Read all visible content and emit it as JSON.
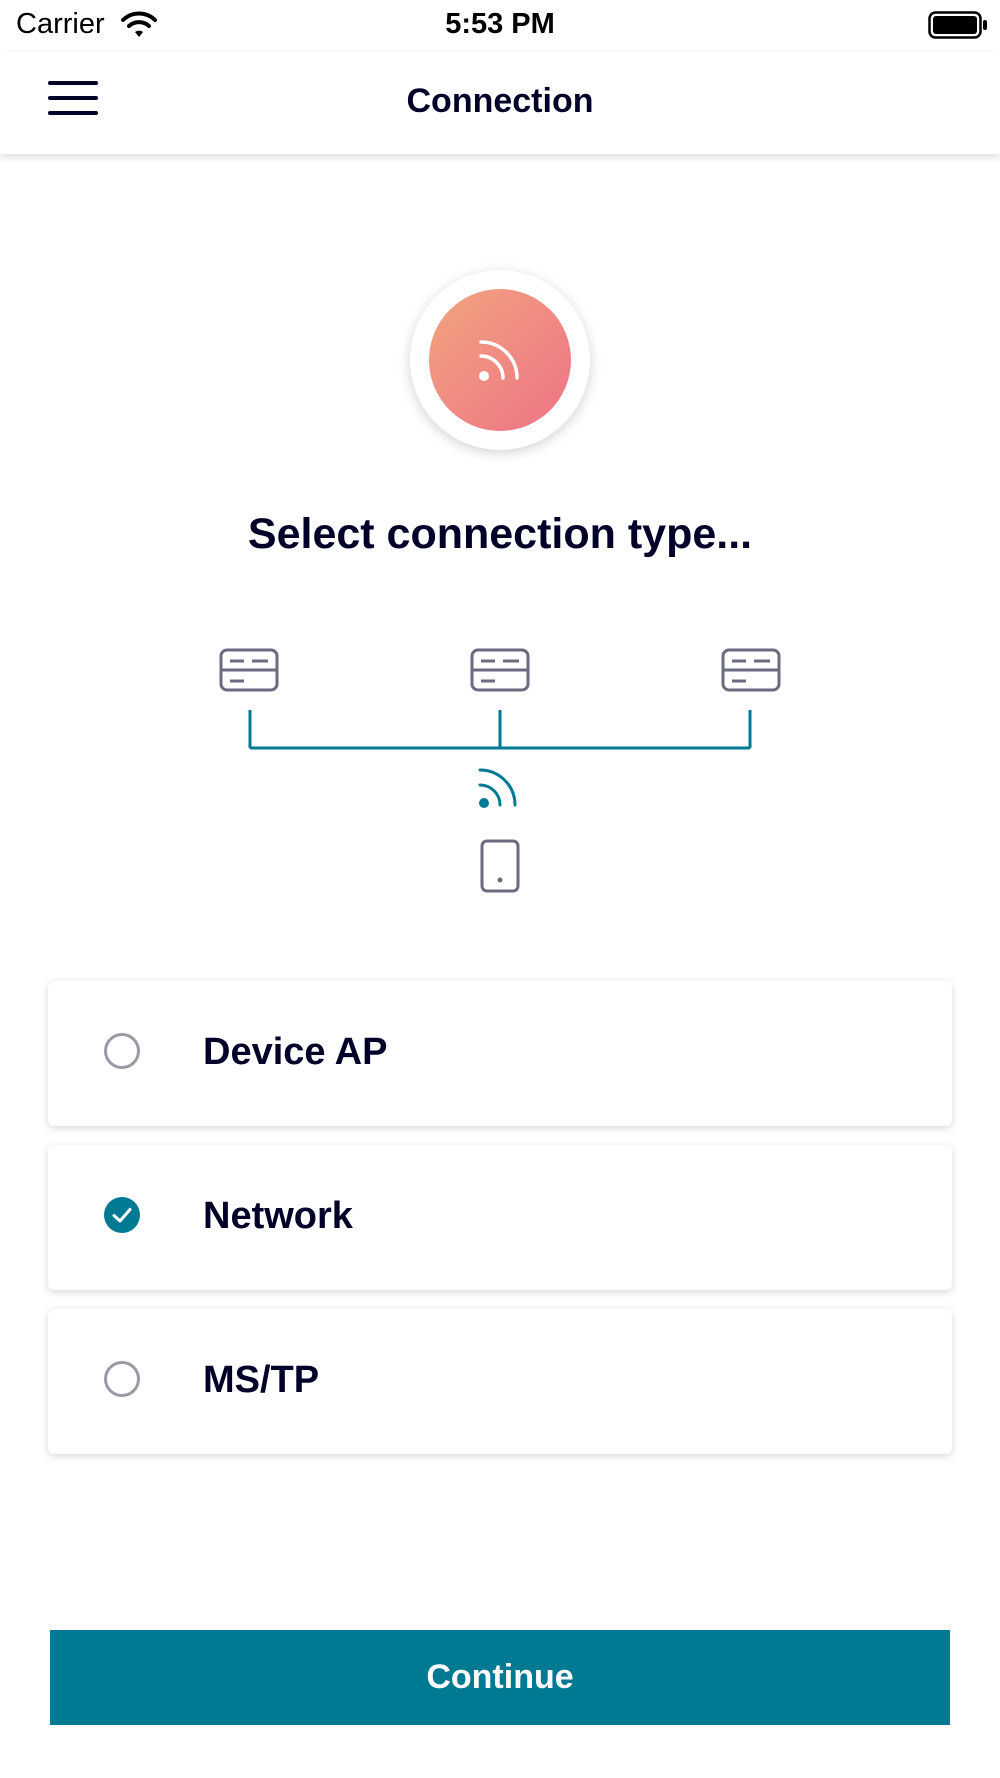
{
  "status_bar": {
    "carrier": "Carrier",
    "time": "5:53 PM",
    "wifi_icon": "wifi-icon",
    "battery_icon": "battery-icon"
  },
  "header": {
    "title": "Connection",
    "menu_icon": "hamburger-menu-icon"
  },
  "hero": {
    "icon": "wireless-signal-icon",
    "gradient": [
      "#f0a47e",
      "#ef7386"
    ]
  },
  "prompt": "Select connection type...",
  "diagram": {
    "icons": [
      "device-icon",
      "device-icon",
      "device-icon",
      "wireless-signal-icon",
      "phone-icon"
    ]
  },
  "options": [
    {
      "label": "Device AP",
      "selected": false
    },
    {
      "label": "Network",
      "selected": true
    },
    {
      "label": "MS/TP",
      "selected": false
    }
  ],
  "continue_label": "Continue",
  "colors": {
    "accent": "#007993",
    "text": "#000028",
    "radio_border": "#9a9aa6"
  }
}
